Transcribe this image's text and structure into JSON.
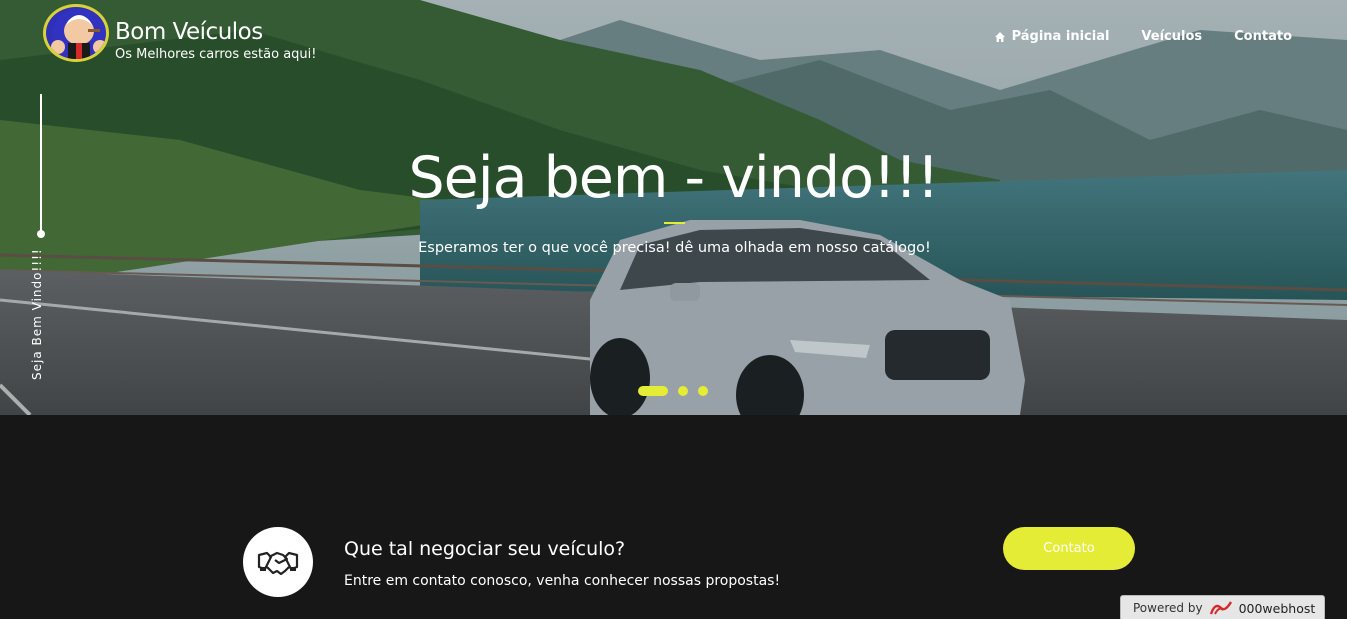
{
  "brand": {
    "title": "Bom Veículos",
    "subtitle": "Os Melhores carros estão aqui!"
  },
  "nav": {
    "items": [
      {
        "label": "Página inicial",
        "icon": "home-icon"
      },
      {
        "label": "Veículos"
      },
      {
        "label": "Contato"
      }
    ]
  },
  "hero": {
    "side_label": "Seja Bem Vindo!!!!",
    "title": "Seja bem - vindo!!!",
    "subtitle": "Esperamos ter o que você precisa! dê uma olhada em nosso catálogo!",
    "slides_count": 3,
    "active_slide": 1
  },
  "cta": {
    "icon": "handshake-icon",
    "title": "Que tal negociar seu veículo?",
    "text": "Entre em contato conosco, venha conhecer nossas propostas!",
    "button_label": "Contato"
  },
  "badge": {
    "prefix": "Powered by",
    "name": "000webhost"
  },
  "colors": {
    "accent": "#e4ec35",
    "background": "#171717"
  }
}
